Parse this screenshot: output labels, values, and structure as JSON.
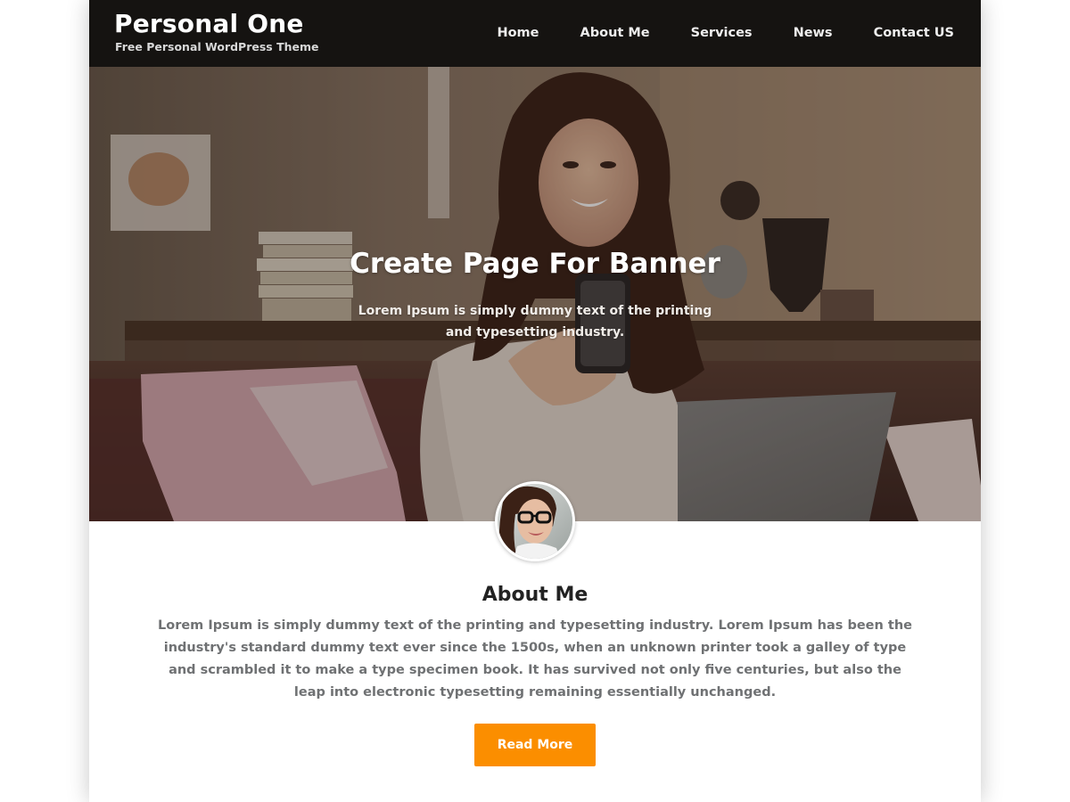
{
  "header": {
    "site_title": "Personal One",
    "tagline": "Free Personal WordPress Theme",
    "nav": [
      {
        "label": "Home"
      },
      {
        "label": "About Me"
      },
      {
        "label": "Services"
      },
      {
        "label": "News"
      },
      {
        "label": "Contact US"
      }
    ]
  },
  "hero": {
    "title": "Create Page For Banner",
    "text": "Lorem Ipsum is simply dummy text of the printing and typesetting industry."
  },
  "about": {
    "heading": "About Me",
    "text": "Lorem Ipsum is simply dummy text of the printing and typesetting industry. Lorem Ipsum has been the industry's standard dummy text ever since the 1500s, when an unknown printer took a galley of type and scrambled it to make a type specimen book. It has survived not only five centuries, but also the leap into electronic typesetting remaining essentially unchanged.",
    "button_label": "Read More"
  },
  "colors": {
    "header_bg": "#151311",
    "accent": "#fb8e00",
    "body_text": "#6f7173",
    "heading_text": "#222222"
  },
  "icons": {
    "avatar": "woman-with-glasses-avatar",
    "hero_image": "woman-with-phone-and-laptop-photo"
  }
}
